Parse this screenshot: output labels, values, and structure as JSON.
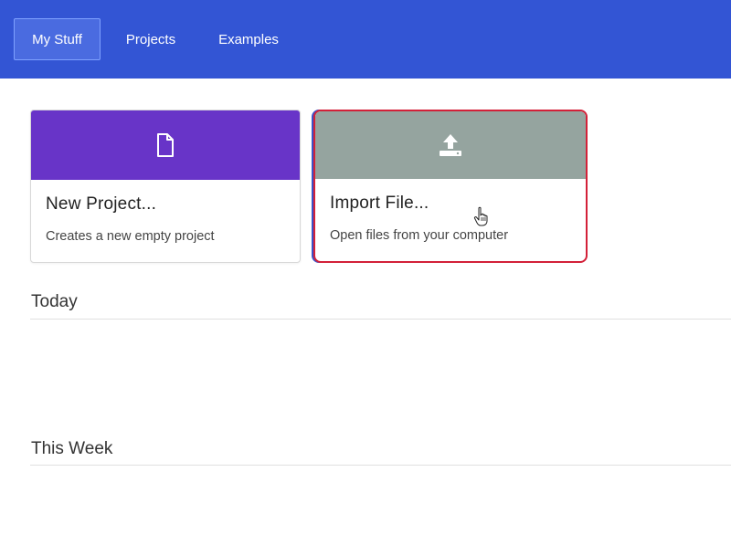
{
  "nav": {
    "tabs": [
      {
        "label": "My Stuff",
        "active": true
      },
      {
        "label": "Projects",
        "active": false
      },
      {
        "label": "Examples",
        "active": false
      }
    ]
  },
  "cards": {
    "new_project": {
      "title": "New Project...",
      "description": "Creates a new empty project",
      "icon": "file-icon",
      "color": "#6834c8"
    },
    "import_file": {
      "title": "Import File...",
      "description": "Open files from your computer",
      "icon": "upload-icon",
      "color": "#95a49f",
      "highlight_color": "#d32038"
    }
  },
  "sections": {
    "today": "Today",
    "this_week": "This Week"
  },
  "colors": {
    "topbar": "#3355d4"
  }
}
